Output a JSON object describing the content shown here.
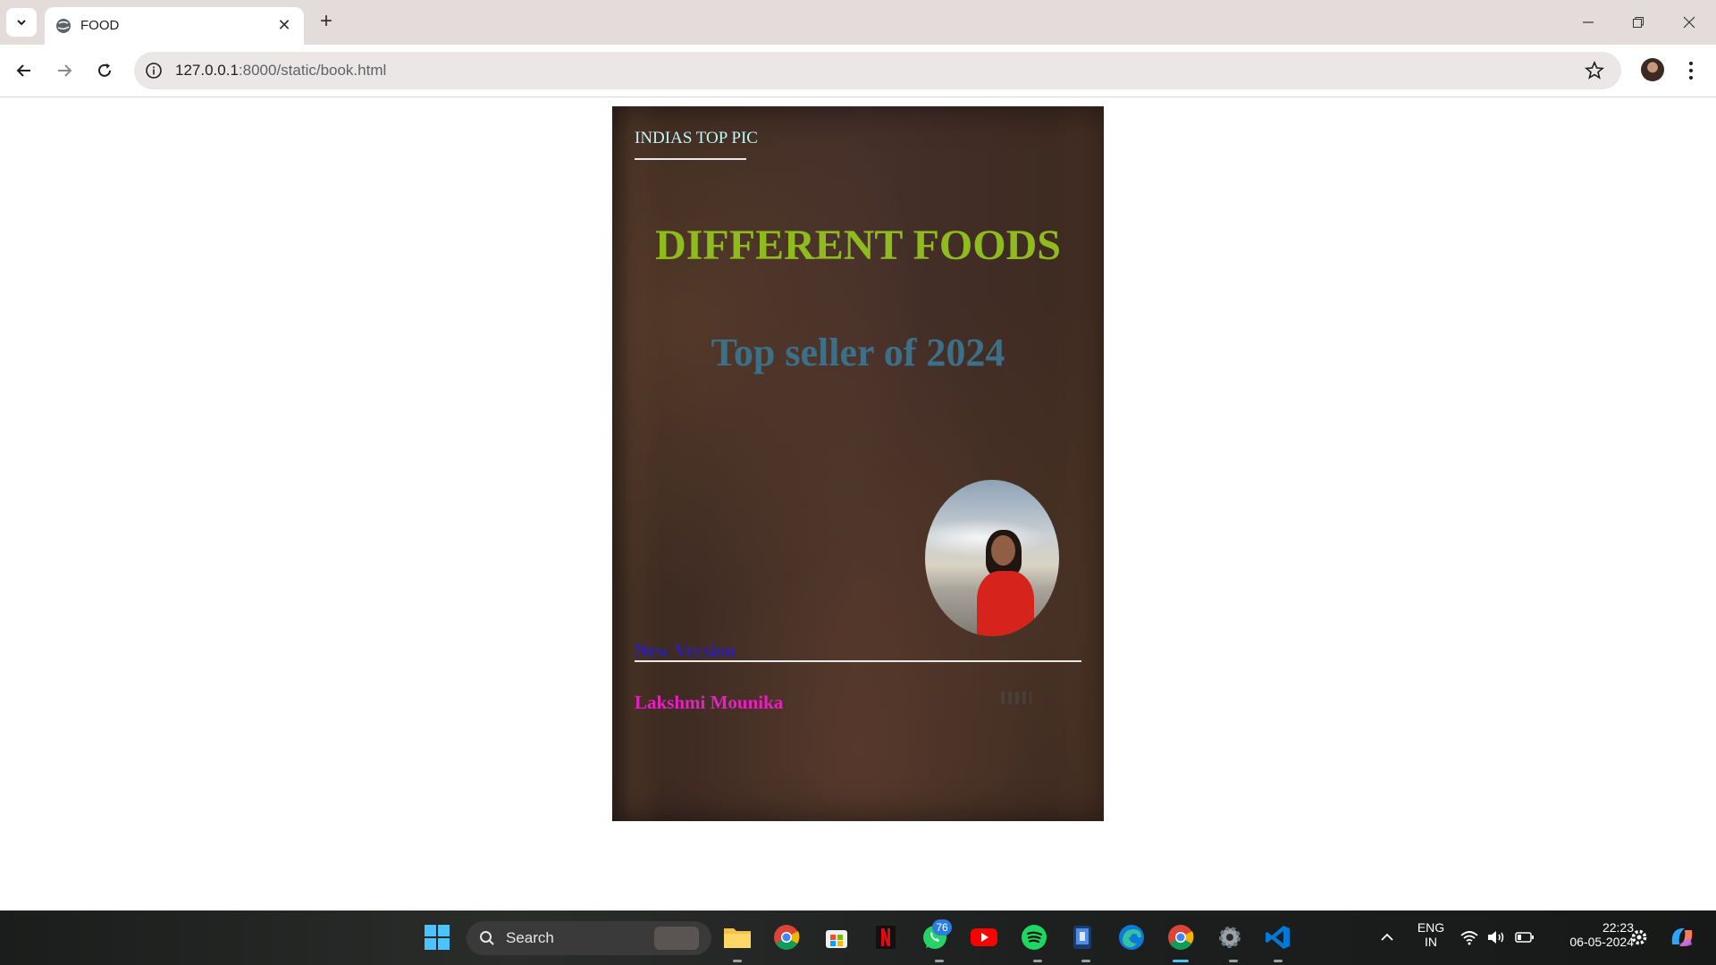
{
  "browser": {
    "tab_title": "FOOD",
    "url_host": "127.0.0.1",
    "url_rest": ":8000/static/book.html"
  },
  "book": {
    "tag": "INDIAS TOP PIC",
    "title": "DIFFERENT FOODS",
    "subtitle": "Top seller of 2024",
    "version": "New Version",
    "author": "Lakshmi Mounika"
  },
  "taskbar": {
    "search_label": "Search",
    "whatsapp_badge": "76",
    "language": "ENG",
    "region": "IN",
    "time": "22:23",
    "date": "06-05-2024"
  }
}
